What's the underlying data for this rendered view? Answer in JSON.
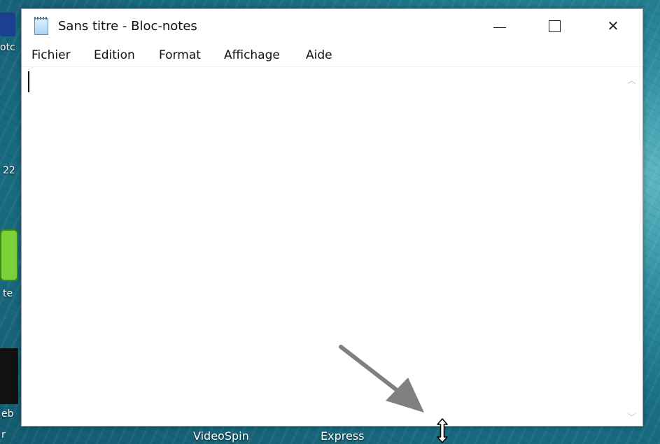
{
  "desktop": {
    "fragment_labels": [
      "otc",
      "22",
      "te",
      "eb",
      "r"
    ],
    "taskbar_labels": [
      "VideoSpin",
      "Express"
    ]
  },
  "window": {
    "title": "Sans titre - Bloc-notes",
    "controls": {
      "minimize_icon": "minimize-icon",
      "maximize_icon": "maximize-icon",
      "close_icon": "close-icon",
      "close_glyph": "✕"
    },
    "menu": [
      {
        "label": "Fichier"
      },
      {
        "label": "Edition"
      },
      {
        "label": "Format"
      },
      {
        "label": "Affichage"
      },
      {
        "label": "Aide"
      }
    ],
    "editor": {
      "content": ""
    },
    "scrollbar": {
      "up_glyph": "︿",
      "down_glyph": "﹀"
    }
  },
  "overlay": {
    "arrow_color": "#808080",
    "cursor": "vertical-resize-cursor"
  }
}
